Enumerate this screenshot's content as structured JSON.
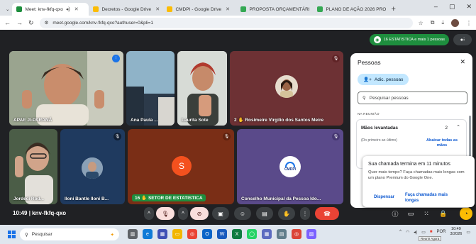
{
  "tabs": [
    {
      "label": "Meet: knv-fkfq-qxo",
      "color": "#1e8e3e",
      "active": true
    },
    {
      "label": "Decretos - Google Drive",
      "color": "#fbbc04",
      "active": false
    },
    {
      "label": "CMDPI - Google Drive",
      "color": "#fbbc04",
      "active": false
    },
    {
      "label": "PROPOSTA ORÇAMENTÁRI",
      "color": "#34a853",
      "active": false
    },
    {
      "label": "PLANO DE AÇÃO 2026 PRO",
      "color": "#34a853",
      "active": false
    }
  ],
  "address": {
    "url": "meet.google.com/knv-fkfq-qxo?authuser=0&pli=1"
  },
  "meet": {
    "stat_badge": "16 ESTATISTICA e mais 1 pessoas",
    "meeting_time": "10:49",
    "meeting_code": "knv-fkfq-qxo"
  },
  "tiles": [
    {
      "name": "APAE JI-PARANÁ"
    },
    {
      "name": "Ana Paula ..."
    },
    {
      "name": "Laurita Sote"
    },
    {
      "name": "Rosimeire Virgilio dos Santos Meire",
      "count": "2"
    },
    {
      "name": "Jordeci Rod..."
    },
    {
      "name": "Iloni Bantle Iloni B..."
    },
    {
      "name": "SETOR DE ESTATISTICA",
      "count": "16",
      "initial": "S"
    },
    {
      "name": "Conselho Municipal da Pessoa Ido...",
      "logo_text": "CMDPI"
    }
  ],
  "panel": {
    "title": "Pessoas",
    "add_label": "Adic. pessoas",
    "search_placeholder": "Pesquisar pessoas",
    "section": "NA REUNIÃO",
    "raised_title": "Mãos levantadas",
    "raised_count": "2",
    "order_label": "(Do primeiro ao último)",
    "lower_all": "Abaixar todas as mãos"
  },
  "toast": {
    "title": "Sua chamada termina em 11 minutos",
    "body": "Quer mais tempo? Faça chamadas mais longas com um plano Premium do Google One.",
    "dismiss": "Dispensar",
    "longer": "Faça chamadas mais longas"
  },
  "taskbar": {
    "search": "Pesquisar",
    "lang": "POR",
    "time": "10:49",
    "date": "3/2026",
    "tooltip": "Reunir Agora"
  },
  "colors": {
    "accent_green": "#1e8e3e",
    "end_call": "#ea4335",
    "link": "#0b57d0"
  }
}
